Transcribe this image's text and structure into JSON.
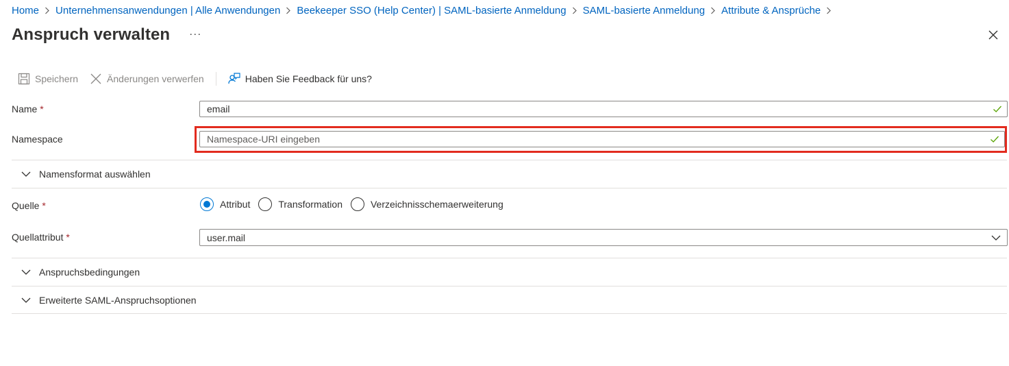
{
  "breadcrumb": {
    "items": [
      {
        "label": "Home"
      },
      {
        "label": "Unternehmensanwendungen | Alle Anwendungen"
      },
      {
        "label": "Beekeeper SSO (Help Center) | SAML-basierte Anmeldung"
      },
      {
        "label": "SAML-basierte Anmeldung"
      },
      {
        "label": "Attribute & Ansprüche"
      }
    ]
  },
  "header": {
    "title": "Anspruch verwalten",
    "more_label": "···",
    "close_icon": "close-icon"
  },
  "toolbar": {
    "save_label": "Speichern",
    "discard_label": "Änderungen verwerfen",
    "feedback_label": "Haben Sie Feedback für uns?"
  },
  "form": {
    "name": {
      "label": "Name",
      "required_mark": "*",
      "value": "email"
    },
    "namespace": {
      "label": "Namespace",
      "placeholder": "Namespace-URI eingeben",
      "value": ""
    },
    "name_format_section": "Namensformat auswählen",
    "source": {
      "label": "Quelle",
      "required_mark": "*",
      "options": [
        {
          "label": "Attribut",
          "selected": true
        },
        {
          "label": "Transformation",
          "selected": false
        },
        {
          "label": "Verzeichnisschemaerweiterung",
          "selected": false
        }
      ]
    },
    "source_attribute": {
      "label": "Quellattribut",
      "required_mark": "*",
      "value": "user.mail"
    },
    "conditions_section": "Anspruchsbedingungen",
    "advanced_section": "Erweiterte SAML-Anspruchsoptionen"
  },
  "colors": {
    "link": "#0064bf",
    "accent": "#0078d4",
    "required": "#a4262c",
    "valid_check": "#57a300",
    "highlight_box": "#e22b1e"
  }
}
